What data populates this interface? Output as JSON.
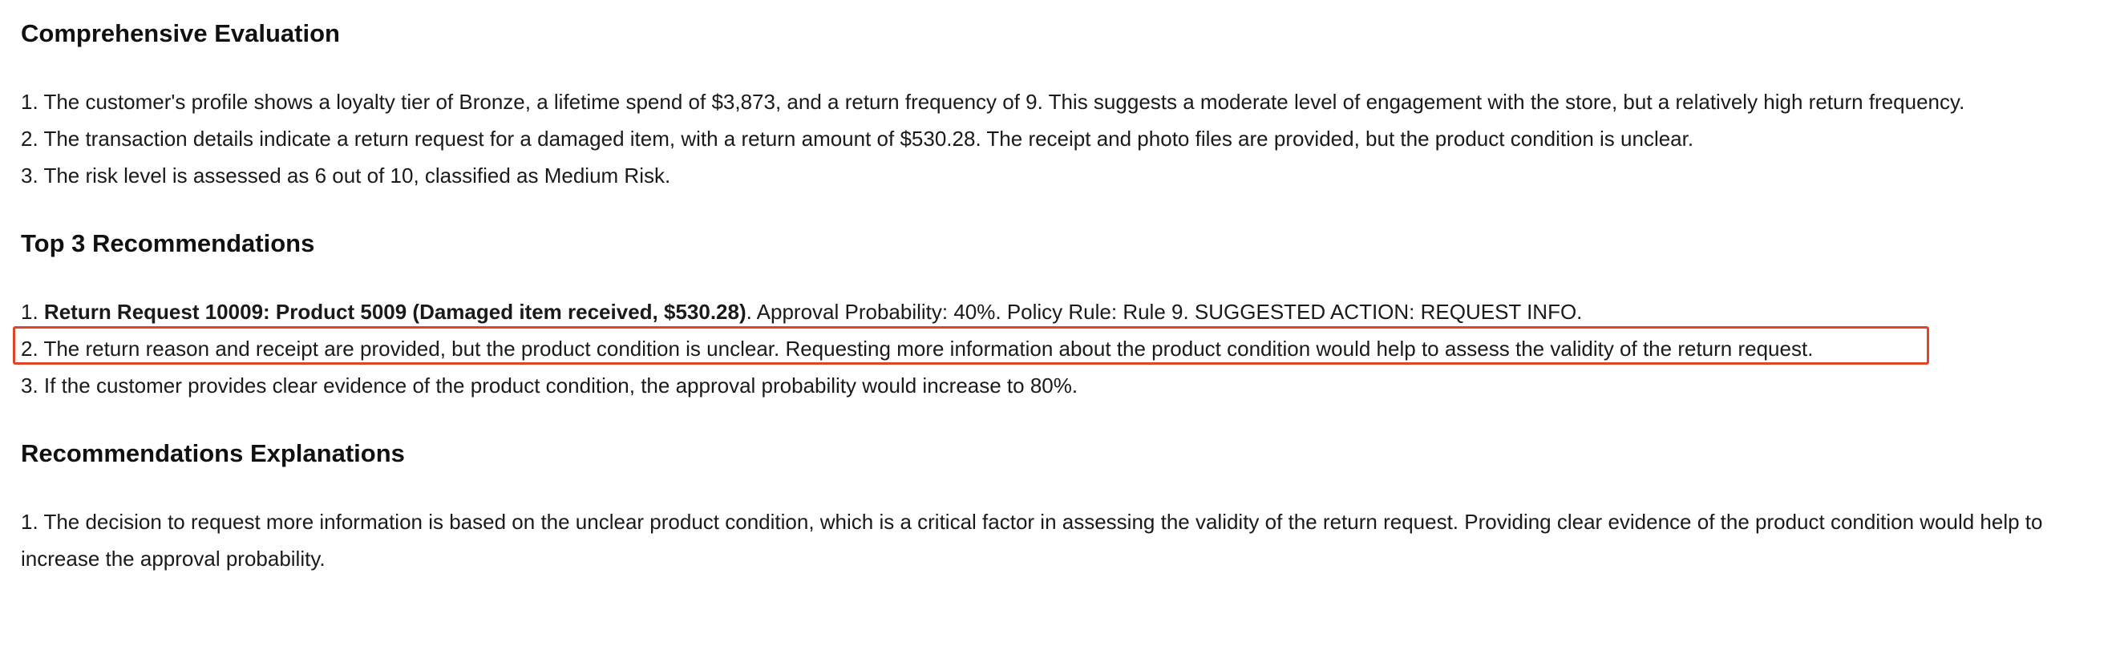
{
  "evaluation": {
    "heading": "Comprehensive Evaluation",
    "items": [
      "1. The customer's profile shows a loyalty tier of Bronze, a lifetime spend of $3,873, and a return frequency of 9. This suggests a moderate level of engagement with the store, but a relatively high return frequency.",
      "2. The transaction details indicate a return request for a damaged item, with a return amount of $530.28. The receipt and photo files are provided, but the product condition is unclear.",
      "3. The risk level is assessed as 6 out of 10, classified as Medium Risk."
    ]
  },
  "recommendations": {
    "heading": "Top 3 Recommendations",
    "item1_prefix": "1. ",
    "item1_bold": "Return Request 10009: Product 5009 (Damaged item received, $530.28)",
    "item1_rest": ". Approval Probability: 40%. Policy Rule: Rule 9. SUGGESTED ACTION: REQUEST INFO.",
    "item2": "2. The return reason and receipt are provided, but the product condition is unclear. Requesting more information about the product condition would help to assess the validity of the return request.",
    "item3": "3. If the customer provides clear evidence of the product condition, the approval probability would increase to 80%."
  },
  "explanations": {
    "heading": "Recommendations Explanations",
    "item1": "1. The decision to request more information is based on the unclear product condition, which is a critical factor in assessing the validity of the return request. Providing clear evidence of the product condition would help to increase the approval probability."
  },
  "highlight_color": "#e0452a"
}
